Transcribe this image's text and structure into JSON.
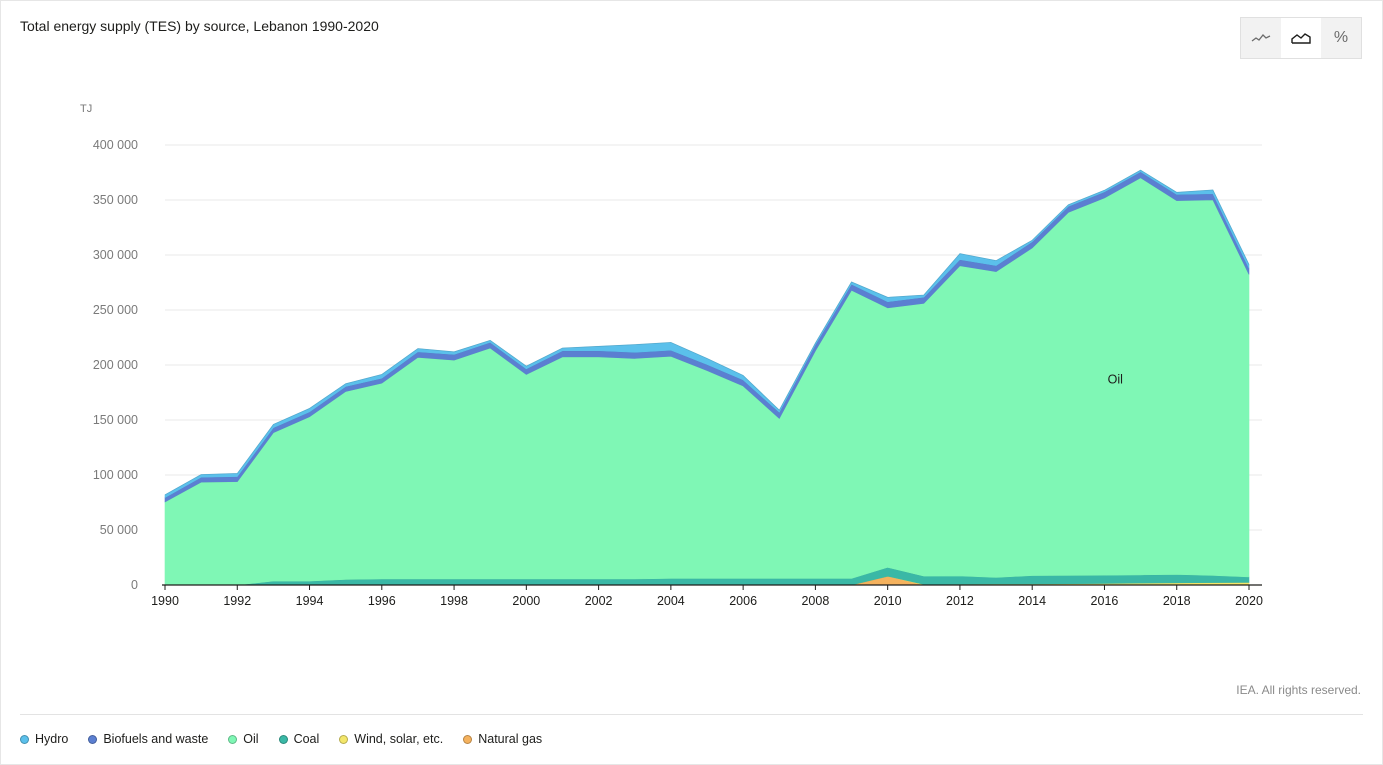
{
  "title": "Total energy supply (TES) by source, Lebanon 1990-2020",
  "view_toggle": {
    "buttons": [
      {
        "name": "line-chart-icon",
        "symbol": "line",
        "active": false
      },
      {
        "name": "area-chart-icon",
        "symbol": "area",
        "active": true
      },
      {
        "name": "percent-icon",
        "symbol": "%",
        "active": false
      }
    ]
  },
  "credit": "IEA. All rights reserved.",
  "legend": [
    {
      "label": "Hydro",
      "color": "#5bc0eb"
    },
    {
      "label": "Biofuels and waste",
      "color": "#5b7fd1"
    },
    {
      "label": "Oil",
      "color": "#7ff7b5"
    },
    {
      "label": "Coal",
      "color": "#3ab8a6"
    },
    {
      "label": "Wind, solar, etc.",
      "color": "#f3e66a"
    },
    {
      "label": "Natural gas",
      "color": "#f5b25e"
    }
  ],
  "chart_data": {
    "type": "area",
    "stacked": true,
    "title": "Total energy supply (TES) by source, Lebanon 1990-2020",
    "unit_label": "TJ",
    "ylim": [
      0,
      400000
    ],
    "y_ticks": [
      0,
      50000,
      100000,
      150000,
      200000,
      250000,
      300000,
      350000,
      400000
    ],
    "y_tick_labels": [
      "0",
      "50 000",
      "100 000",
      "150 000",
      "200 000",
      "250 000",
      "300 000",
      "350 000",
      "400 000"
    ],
    "x": [
      1990,
      1991,
      1992,
      1993,
      1994,
      1995,
      1996,
      1997,
      1998,
      1999,
      2000,
      2001,
      2002,
      2003,
      2004,
      2005,
      2006,
      2007,
      2008,
      2009,
      2010,
      2011,
      2012,
      2013,
      2014,
      2015,
      2016,
      2017,
      2018,
      2019,
      2020
    ],
    "x_ticks": [
      1990,
      1992,
      1994,
      1996,
      1998,
      2000,
      2002,
      2004,
      2006,
      2008,
      2010,
      2012,
      2014,
      2016,
      2018,
      2020
    ],
    "grid": true,
    "annotations": [
      {
        "text": "Oil",
        "x": 2016.3,
        "y": 183000
      }
    ],
    "series": [
      {
        "name": "Natural gas",
        "color": "#f5b25e",
        "values": [
          0,
          0,
          0,
          0,
          0,
          0,
          0,
          0,
          0,
          0,
          0,
          0,
          0,
          0,
          0,
          0,
          0,
          0,
          0,
          0,
          8000,
          0,
          0,
          0,
          0,
          0,
          0,
          0,
          0,
          0,
          0
        ]
      },
      {
        "name": "Wind, solar, etc.",
        "color": "#f3e66a",
        "values": [
          0,
          0,
          0,
          0,
          0,
          0,
          0,
          0,
          0,
          0,
          0,
          0,
          0,
          0,
          0,
          0,
          0,
          0,
          0,
          0,
          0,
          600,
          800,
          900,
          1000,
          1200,
          1400,
          1700,
          2000,
          2200,
          2400
        ]
      },
      {
        "name": "Coal",
        "color": "#3ab8a6",
        "values": [
          0,
          0,
          0,
          3500,
          3500,
          5000,
          5500,
          5500,
          5500,
          5500,
          5500,
          5500,
          5500,
          5500,
          6000,
          6000,
          6000,
          6000,
          6000,
          6000,
          8000,
          7500,
          7500,
          6000,
          7500,
          7500,
          7500,
          7500,
          7500,
          6500,
          5000
        ]
      },
      {
        "name": "Oil",
        "color": "#7ff7b5",
        "values": [
          75500,
          93500,
          94000,
          135000,
          149500,
          171000,
          178000,
          201500,
          199000,
          210000,
          186000,
          202000,
          202000,
          200500,
          202000,
          189000,
          175000,
          145500,
          207000,
          262000,
          236000,
          248000,
          282000,
          278000,
          298000,
          330000,
          343000,
          361000,
          340000,
          341500,
          275000
        ]
      },
      {
        "name": "Biofuels and waste",
        "color": "#5b7fd1",
        "values": [
          4000,
          4500,
          4500,
          4500,
          4500,
          4500,
          4500,
          5000,
          5000,
          5000,
          5000,
          5500,
          5500,
          5500,
          5500,
          5500,
          5500,
          5500,
          5500,
          5500,
          5500,
          5500,
          5500,
          5500,
          5500,
          5500,
          5500,
          5500,
          5500,
          5500,
          5500
        ]
      },
      {
        "name": "Hydro",
        "color": "#5bc0eb",
        "values": [
          2500,
          2500,
          3000,
          3000,
          3000,
          2500,
          3500,
          3000,
          2500,
          2000,
          2500,
          2500,
          4000,
          7000,
          7000,
          5500,
          4000,
          2000,
          1500,
          2000,
          4000,
          2000,
          5500,
          4500,
          1500,
          1500,
          1500,
          1500,
          2000,
          3500,
          3500
        ]
      }
    ]
  }
}
